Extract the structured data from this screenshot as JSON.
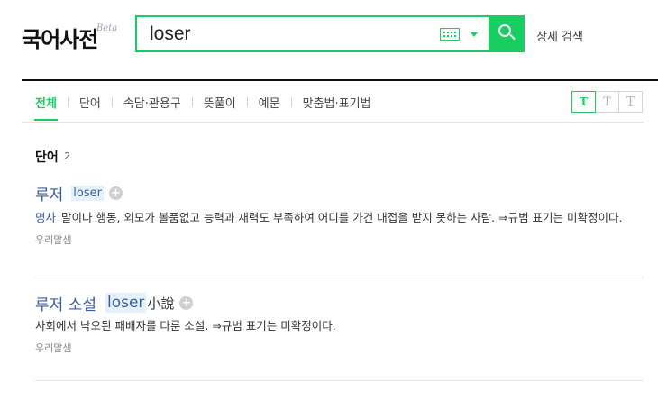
{
  "header": {
    "logo": "국어사전",
    "beta": "Beta",
    "search_value": "loser",
    "detail_search": "상세 검색"
  },
  "tabs": [
    {
      "label": "전체",
      "active": true
    },
    {
      "label": "단어"
    },
    {
      "label": "속담·관용구"
    },
    {
      "label": "뜻풀이"
    },
    {
      "label": "예문"
    },
    {
      "label": "맞춤법·표기법"
    }
  ],
  "font_sizes": [
    "T",
    "T",
    "T"
  ],
  "section": {
    "title": "단어",
    "count": "2"
  },
  "entries": [
    {
      "word": "루저",
      "origin": "loser",
      "hanja": "",
      "pos": "명사",
      "definition": "말이나 행동, 외모가 볼품없고 능력과 재력도 부족하여 어디를 가건 대접을 받지 못하는 사람. ⇒규범 표기는 미확정이다.",
      "source": "우리말샘"
    },
    {
      "word": "루저 소설",
      "origin": "loser",
      "hanja": "小說",
      "pos": "",
      "definition": "사회에서 낙오된 패배자를 다룬 소설. ⇒규범 표기는 미확정이다.",
      "source": "우리말샘"
    }
  ],
  "colors": {
    "accent": "#19ce60",
    "link": "#3b5ea6"
  }
}
